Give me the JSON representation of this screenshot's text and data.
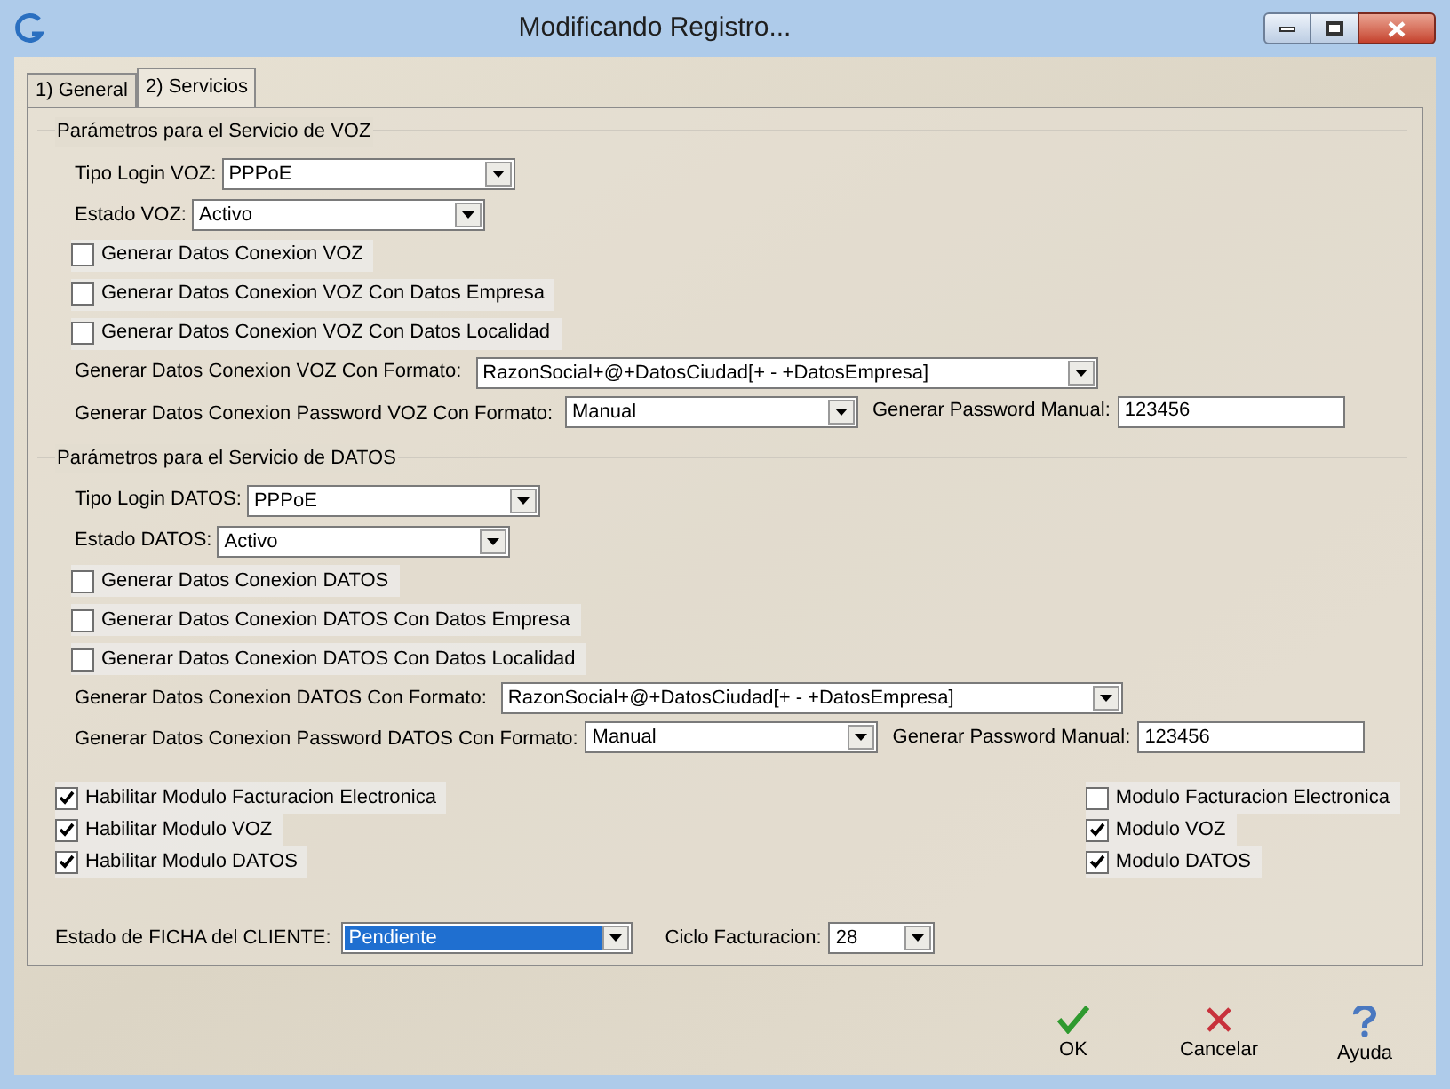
{
  "window": {
    "title": "Modificando Registro..."
  },
  "tabs": [
    {
      "label": "1) General",
      "selected": false
    },
    {
      "label": "2) Servicios",
      "selected": true
    }
  ],
  "sections": [
    {
      "title": "Parámetros para el Servicio de VOZ",
      "rows": [
        {
          "kind": "select",
          "label": "Tipo Login VOZ:",
          "value": "PPPoE"
        },
        {
          "kind": "select",
          "label": "Estado VOZ:",
          "value": "Activo"
        },
        {
          "kind": "checkbox",
          "label": "Generar Datos Conexion VOZ",
          "checked": false
        },
        {
          "kind": "checkbox",
          "label": "Generar Datos Conexion VOZ Con Datos Empresa",
          "checked": false
        },
        {
          "kind": "checkbox",
          "label": "Generar Datos Conexion VOZ Con Datos Localidad",
          "checked": false
        },
        {
          "kind": "format",
          "label": "Generar Datos Conexion VOZ Con Formato:",
          "value": "RazonSocial+@+DatosCiudad[+ - +DatosEmpresa]"
        },
        {
          "kind": "password",
          "label": "Generar Datos Conexion Password VOZ Con Formato:",
          "value": "Manual",
          "manual_label": "Generar Password Manual:",
          "manual_value": "123456"
        }
      ]
    },
    {
      "title": "Parámetros para el Servicio de DATOS",
      "rows": [
        {
          "kind": "select",
          "label": "Tipo Login DATOS:",
          "value": "PPPoE"
        },
        {
          "kind": "select",
          "label": "Estado DATOS:",
          "value": "Activo"
        },
        {
          "kind": "checkbox",
          "label": "Generar Datos Conexion DATOS",
          "checked": false
        },
        {
          "kind": "checkbox",
          "label": "Generar Datos Conexion DATOS Con Datos Empresa",
          "checked": false
        },
        {
          "kind": "checkbox",
          "label": "Generar Datos Conexion DATOS Con Datos Localidad",
          "checked": false
        },
        {
          "kind": "format",
          "label": "Generar Datos Conexion DATOS Con Formato:",
          "value": "RazonSocial+@+DatosCiudad[+ - +DatosEmpresa]"
        },
        {
          "kind": "password",
          "label": "Generar Datos Conexion Password DATOS Con Formato:",
          "value": "Manual",
          "manual_label": "Generar Password Manual:",
          "manual_value": "123456"
        }
      ]
    }
  ],
  "modules_left": [
    {
      "label": "Habilitar Modulo Facturacion Electronica",
      "checked": true
    },
    {
      "label": "Habilitar Modulo VOZ",
      "checked": true
    },
    {
      "label": "Habilitar Modulo DATOS",
      "checked": true
    }
  ],
  "modules_right": [
    {
      "label": "Modulo Facturacion Electronica",
      "checked": false
    },
    {
      "label": "Modulo VOZ",
      "checked": true
    },
    {
      "label": "Modulo DATOS",
      "checked": true
    }
  ],
  "client_status": {
    "label": "Estado de FICHA del CLIENTE:",
    "value": "Pendiente",
    "focused": true
  },
  "billing_cycle": {
    "label": "Ciclo Facturacion:",
    "value": "28"
  },
  "buttons": [
    {
      "kind": "ok",
      "label": "OK"
    },
    {
      "kind": "cancel",
      "label": "Cancelar"
    },
    {
      "kind": "help",
      "label": "Ayuda"
    }
  ]
}
